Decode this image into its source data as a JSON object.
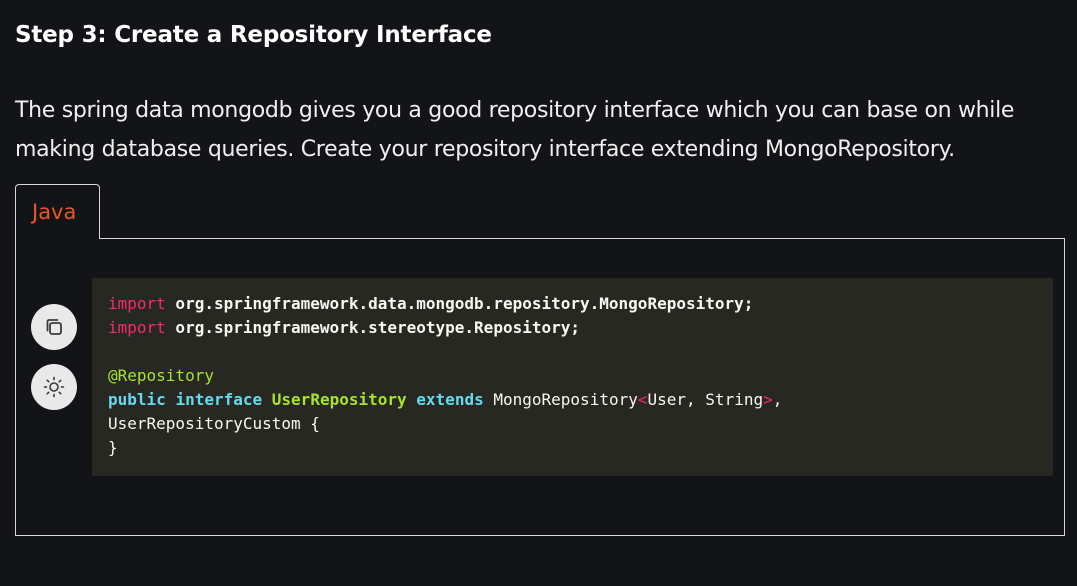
{
  "heading": "Step 3: Create a Repository Interface",
  "description": "The spring data mongodb gives you a good repository interface which you can base on while making database queries. Create your repository interface extending MongoRepository.",
  "tabs": [
    {
      "label": "Java",
      "active": true
    }
  ],
  "toolbar": {
    "copy_icon": "copy-icon",
    "theme_icon": "sun-icon"
  },
  "code": {
    "language": "Java",
    "lines": [
      {
        "kw": "import",
        "rest": " org.springframework.data.mongodb.repository.MongoRepository;"
      },
      {
        "kw": "import",
        "rest": " org.springframework.stereotype.Repository;"
      },
      {
        "annotation": "@Repository"
      },
      {
        "kw_public": "public",
        "kw_interface": "interface",
        "class_name": "UserRepository",
        "kw_extends": "extends",
        "base": "MongoRepository",
        "lt": "<",
        "generics": "User, String",
        "gt": ">",
        "trail": ","
      },
      {
        "text": "UserRepositoryCustom {"
      },
      {
        "text": "}"
      }
    ]
  },
  "colors": {
    "background": "#131417",
    "accent_tab": "#e8562a",
    "code_bg": "#272822",
    "keyword_pink": "#f92672",
    "keyword_blue": "#66d9ef",
    "class_green": "#a6e22e"
  }
}
